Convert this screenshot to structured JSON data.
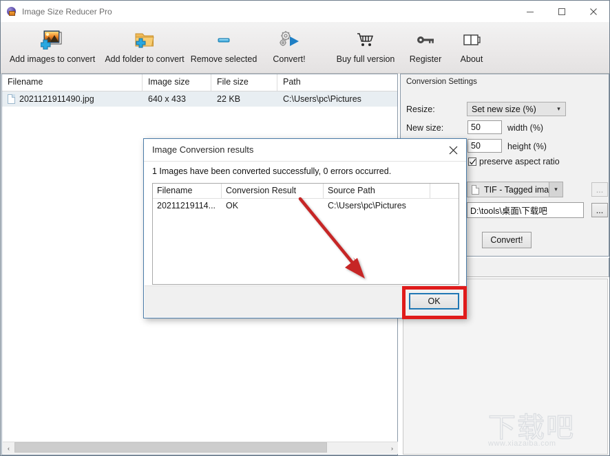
{
  "window": {
    "title": "Image Size Reducer Pro",
    "icon": "app-globe-icon",
    "minimize_label": "Minimize",
    "maximize_label": "Maximize",
    "close_label": "Close"
  },
  "toolbar": {
    "buttons": [
      {
        "label": "Add images to convert",
        "icon": "add-image-icon"
      },
      {
        "label": "Add folder to convert",
        "icon": "add-folder-icon"
      },
      {
        "label": "Remove selected",
        "icon": "remove-icon"
      },
      {
        "label": "Convert!",
        "icon": "gears-play-icon"
      },
      {
        "label": "Buy full version",
        "icon": "shopping-cart-icon"
      },
      {
        "label": "Register",
        "icon": "key-icon"
      },
      {
        "label": "About",
        "icon": "book-icon"
      }
    ]
  },
  "file_list": {
    "columns": [
      "Filename",
      "Image size",
      "File size",
      "Path"
    ],
    "rows": [
      {
        "filename": "2021121911490.jpg",
        "image_size": "640 x 433",
        "file_size": "22 KB",
        "path": "C:\\Users\\pc\\Pictures"
      }
    ],
    "scroll_left_arrow": "‹",
    "scroll_right_arrow": "›"
  },
  "settings": {
    "group_title": "Conversion Settings",
    "resize_label": "Resize:",
    "resize_value": "Set new size (%)",
    "new_size_label": "New size:",
    "width_value": "50",
    "width_unit": "width  (%)",
    "height_value": "50",
    "height_unit": "height (%)",
    "preserve_aspect_label": "preserve aspect ratio",
    "preserve_aspect_checked": true,
    "format_value": "TIF - Tagged image file",
    "format_options_button": "...",
    "output_path": "D:\\tools\\桌面\\下载吧",
    "browse_button": "...",
    "convert_button": "Convert!"
  },
  "dialog": {
    "title": "Image Conversion results",
    "close_icon": "close-icon",
    "message": "1 Images have been converted successfully, 0 errors occurred.",
    "columns": [
      "Filename",
      "Conversion Result",
      "Source Path"
    ],
    "rows": [
      {
        "filename": "20211219114...",
        "result": "OK",
        "source_path": "C:\\Users\\pc\\Pictures"
      }
    ],
    "ok_button": "OK"
  },
  "annotations": {
    "arrow_color": "#c62828",
    "highlight_color": "#e01b1b",
    "highlight_target": "ok-button"
  },
  "watermark": {
    "text": "下载吧",
    "url": "www.xiazaiba.com"
  }
}
